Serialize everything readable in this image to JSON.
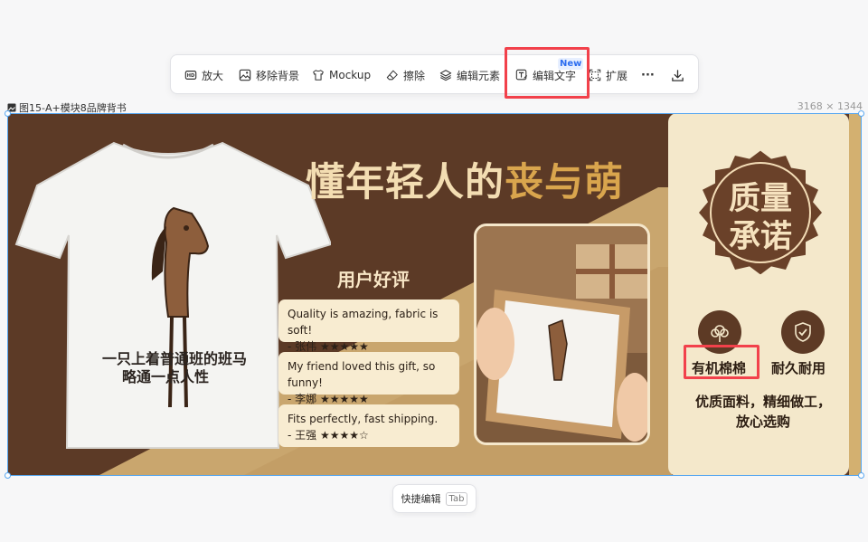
{
  "toolbar": {
    "items": [
      {
        "label": "放大",
        "icon": "hd-icon"
      },
      {
        "label": "移除背景",
        "icon": "image-icon"
      },
      {
        "label": "Mockup",
        "icon": "tshirt-icon"
      },
      {
        "label": "擦除",
        "icon": "eraser-icon"
      },
      {
        "label": "编辑元素",
        "icon": "layers-icon"
      },
      {
        "label": "编辑文字",
        "icon": "text-edit-icon"
      },
      {
        "label": "扩展",
        "icon": "expand-icon"
      }
    ],
    "more": "···",
    "new_badge": "New"
  },
  "document": {
    "title": "图15-A+模块8品牌背书",
    "size": "3168 × 1344"
  },
  "banner": {
    "headline_main": "懂年轻人的",
    "headline_accent": "丧与萌",
    "shirt_text_line1": "一只上着普通班的班马",
    "shirt_text_line2": "略通一点人性",
    "reviews_title": "用户好评",
    "reviews": [
      {
        "text": "Quality is amazing, fabric is soft!",
        "name": "- 张伟",
        "stars": "★★★★★"
      },
      {
        "text": "My friend loved this gift, so funny!",
        "name": "- 李娜",
        "stars": "★★★★★"
      },
      {
        "text": "Fits perfectly, fast shipping.",
        "name": "- 王强",
        "stars": "★★★★☆"
      }
    ],
    "quality_line1": "质量",
    "quality_line2": "承诺",
    "feature_cotton": "有机棉棉",
    "feature_durable": "耐久耐用",
    "promise_line1": "优质面料，精细做工，",
    "promise_line2": "放心选购"
  },
  "quick_edit": {
    "label": "快捷编辑",
    "shortcut": "Tab"
  },
  "colors": {
    "brown": "#5c3a26",
    "cream": "#f4e8cb",
    "gold": "#d9a54d",
    "highlight": "#f2414b",
    "accent_blue": "#2c6df0"
  }
}
